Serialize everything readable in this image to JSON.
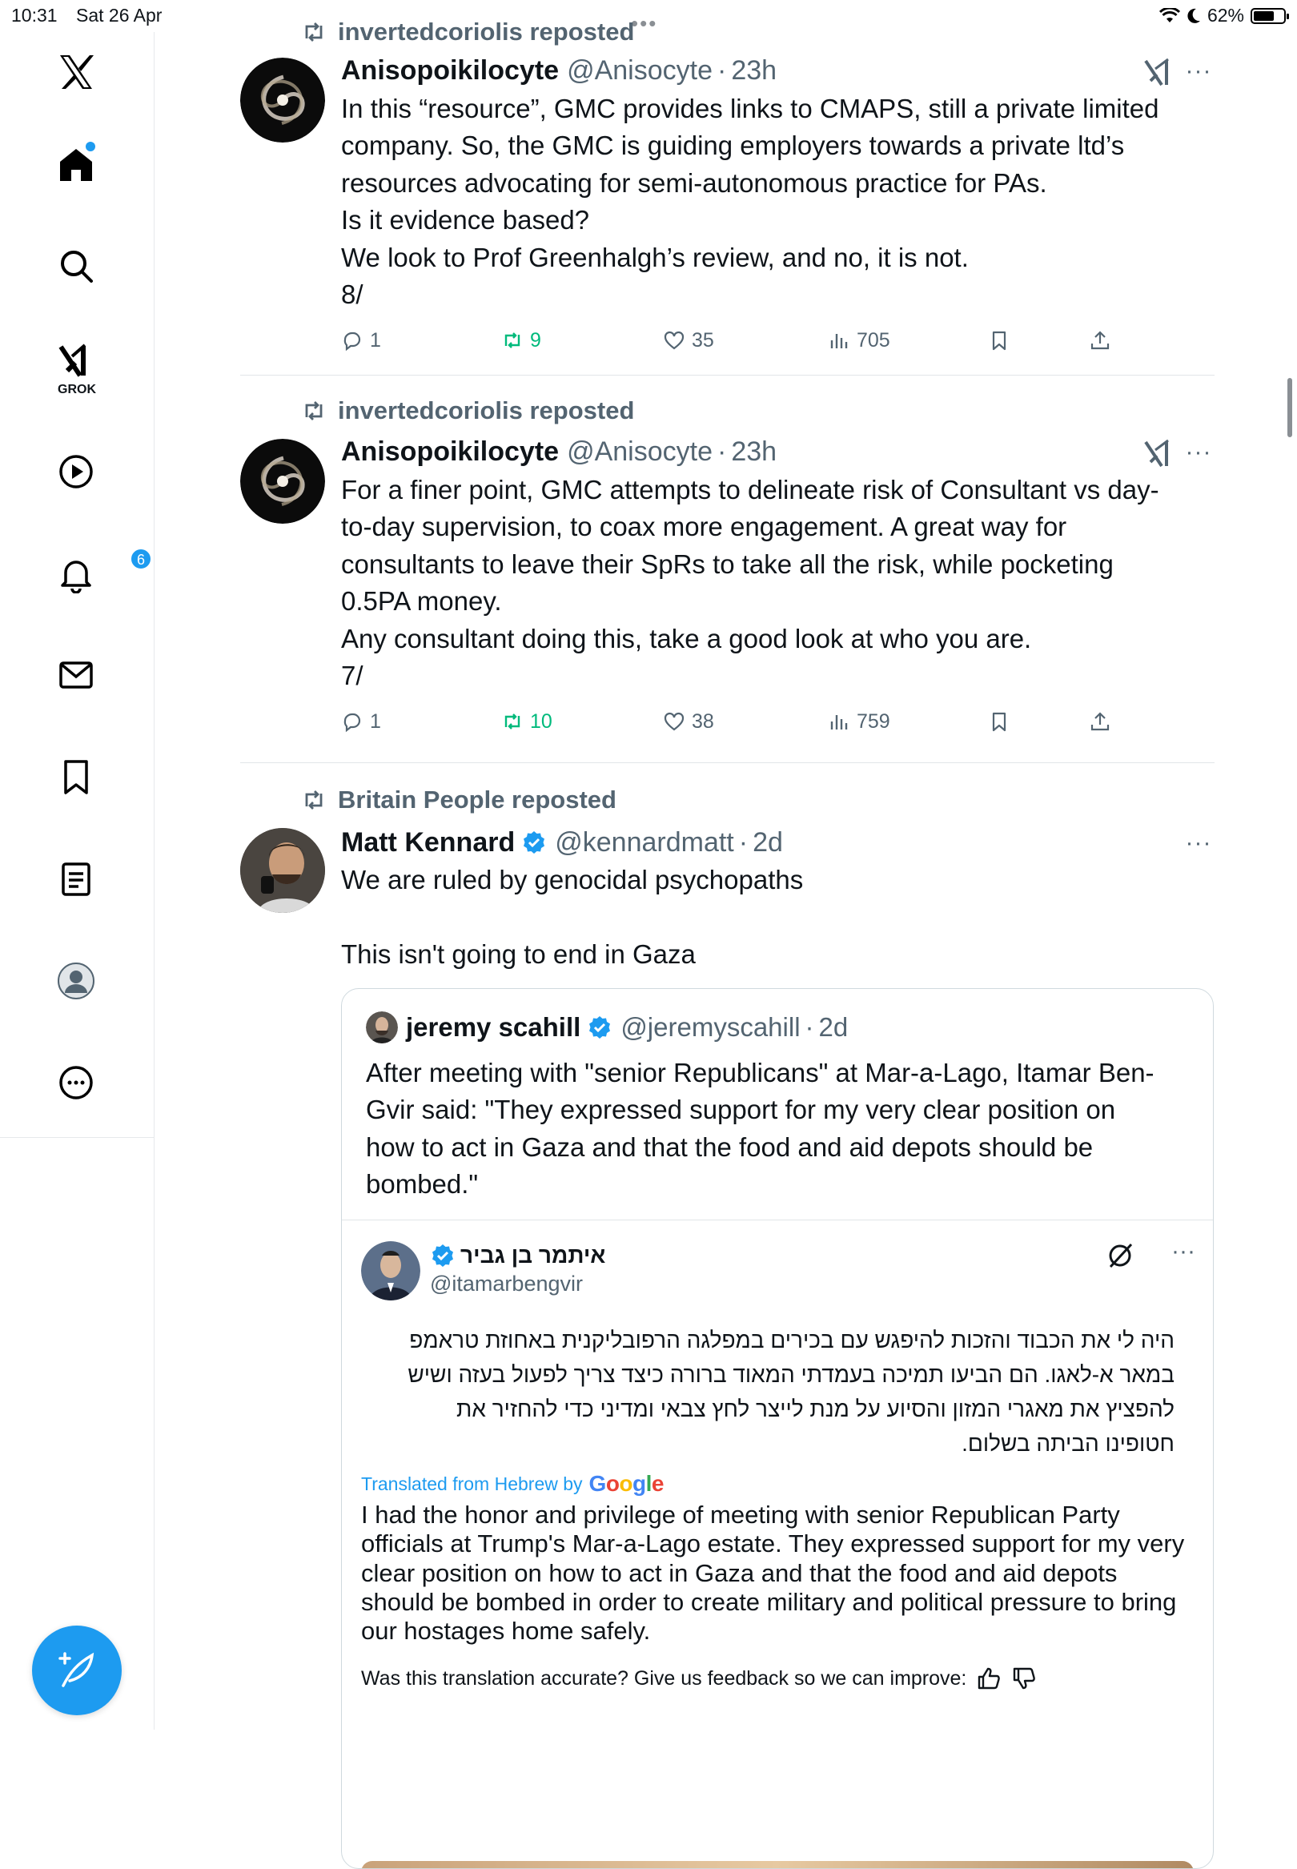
{
  "status": {
    "time": "10:31",
    "date": "Sat 26 Apr",
    "battery": "62%"
  },
  "nav": {
    "items": [
      "Home",
      "Search",
      "Grok",
      "Video",
      "Notifications",
      "Messages",
      "Bookmarks",
      "Lists",
      "Profile",
      "More"
    ],
    "grok_label": "GROK",
    "notifications_badge": "6"
  },
  "posts": [
    {
      "reposted_by": "invertedcoriolis reposted",
      "name": "Anisopoikilocyte",
      "handle": "@Anisocyte",
      "dot": "·",
      "time": "23h",
      "text": "In this “resource”, GMC provides links to CMAPS, still a private limited\ncompany. So, the GMC is guiding employers towards a private ltd’s\nresources advocating for semi-autonomous practice for PAs.\nIs it evidence based?\nWe look to Prof Greenhalgh’s review, and no, it is not.\n8/",
      "replies": "1",
      "reposts": "9",
      "likes": "35",
      "views": "705"
    },
    {
      "reposted_by": "invertedcoriolis reposted",
      "name": "Anisopoikilocyte",
      "handle": "@Anisocyte",
      "dot": "·",
      "time": "23h",
      "text": "For a finer point, GMC attempts to delineate risk of Consultant vs day-\nto-day supervision, to coax more engagement. A great way for\nconsultants to leave their SpRs to take all the risk, while pocketing\n0.5PA money.\nAny consultant doing this, take a good look at who you are.\n7/",
      "replies": "1",
      "reposts": "10",
      "likes": "38",
      "views": "759"
    },
    {
      "reposted_by": "Britain People reposted",
      "name": "Matt Kennard",
      "handle": "@kennardmatt",
      "dot": "·",
      "time": "2d",
      "text": "We are ruled by genocidal psychopaths\n\nThis isn't going to end in Gaza",
      "quote": {
        "name": "jeremy scahill",
        "handle": "@jeremyscahill",
        "dot": "·",
        "time": "2d",
        "text": "After meeting with \"senior Republicans\" at Mar-a-Lago, Itamar Ben-\nGvir said: \"They expressed support for my very clear position on\nhow to act in Gaza and that the food and aid depots should be\nbombed.\"",
        "inner": {
          "name": "איתמר בן גביר",
          "handle": "@itamarbengvir",
          "hebrew": "היה לי את הכבוד והזכות להיפגש עם בכירים במפלגה הרפובליקנית באחוזת טראמפ במאר א-לאגו. הם הביעו תמיכה בעמדתי המאוד ברורה כיצד צריך לפעול בעזה ושיש להפציץ את מאגרי המזון והסיוע על מנת לייצר לחץ צבאי ומדיני כדי להחזיר את חטופינו הביתה בשלום.",
          "translated_label": "Translated from Hebrew by",
          "google": "Google",
          "translation": "I had the honor and privilege of meeting with senior Republican Party officials at Trump's Mar-a-Lago estate. They expressed support for my very clear position on how to act in Gaza and that the food and aid depots should be bombed in order to create military and political pressure to bring our hostages home safely.",
          "feedback": "Was this translation accurate? Give us feedback so we can improve:"
        }
      }
    }
  ],
  "colors": {
    "accent": "#1d9bf0",
    "repost_green": "#00ba7c",
    "muted": "#536471"
  },
  "icons": [
    "x-logo-icon",
    "home-icon",
    "search-icon",
    "grok-icon",
    "play-icon",
    "bell-icon",
    "mail-icon",
    "bookmark-icon",
    "list-icon",
    "profile-icon",
    "more-icon",
    "compose-icon",
    "repost-icon",
    "reply-icon",
    "like-icon",
    "views-icon",
    "share-icon",
    "verified-icon",
    "translate-icon",
    "thumbs-up-icon",
    "thumbs-down-icon"
  ]
}
